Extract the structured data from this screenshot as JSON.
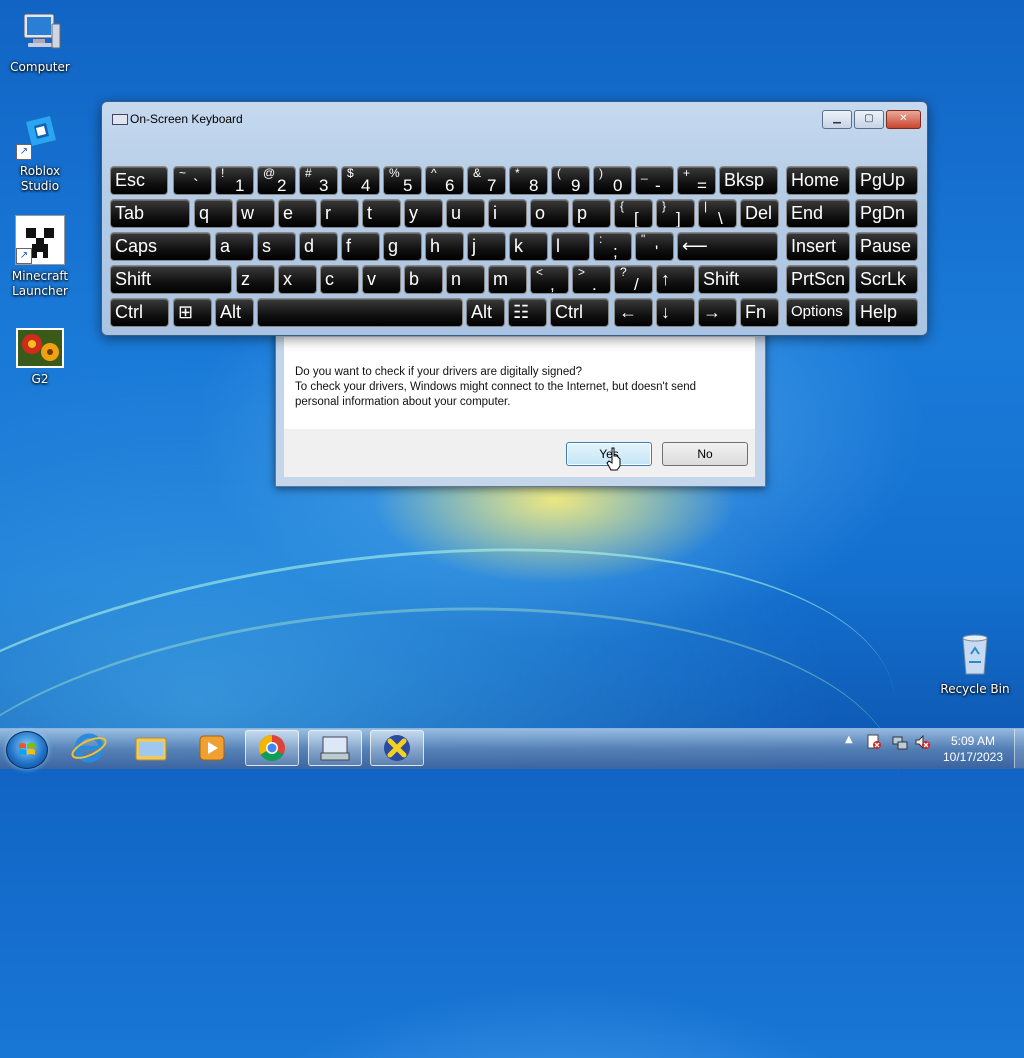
{
  "desktop": {
    "icons": [
      {
        "label": "Computer"
      },
      {
        "label": "Roblox Studio"
      },
      {
        "label": "Minecraft Launcher"
      },
      {
        "label": "G2"
      },
      {
        "label": "Recycle Bin"
      }
    ]
  },
  "osk": {
    "title": "On-Screen Keyboard",
    "rows": [
      [
        {
          "main": "Esc"
        },
        {
          "top": "~",
          "bot": "`"
        },
        {
          "top": "!",
          "bot": "1"
        },
        {
          "top": "@",
          "bot": "2"
        },
        {
          "top": "#",
          "bot": "3"
        },
        {
          "top": "$",
          "bot": "4"
        },
        {
          "top": "%",
          "bot": "5"
        },
        {
          "top": "^",
          "bot": "6"
        },
        {
          "top": "&",
          "bot": "7"
        },
        {
          "top": "*",
          "bot": "8"
        },
        {
          "top": "(",
          "bot": "9"
        },
        {
          "top": ")",
          "bot": "0"
        },
        {
          "top": "_",
          "bot": "-"
        },
        {
          "top": "+",
          "bot": "="
        },
        {
          "main": "Bksp"
        },
        {
          "main": "Home"
        },
        {
          "main": "PgUp"
        }
      ],
      [
        {
          "main": "Tab"
        },
        {
          "main": "q"
        },
        {
          "main": "w"
        },
        {
          "main": "e"
        },
        {
          "main": "r"
        },
        {
          "main": "t"
        },
        {
          "main": "y"
        },
        {
          "main": "u"
        },
        {
          "main": "i"
        },
        {
          "main": "o"
        },
        {
          "main": "p"
        },
        {
          "top": "{",
          "bot": "["
        },
        {
          "top": "}",
          "bot": "]"
        },
        {
          "top": "|",
          "bot": "\\"
        },
        {
          "main": "Del"
        },
        {
          "main": "End"
        },
        {
          "main": "PgDn"
        }
      ],
      [
        {
          "main": "Caps"
        },
        {
          "main": "a"
        },
        {
          "main": "s"
        },
        {
          "main": "d"
        },
        {
          "main": "f"
        },
        {
          "main": "g"
        },
        {
          "main": "h"
        },
        {
          "main": "j"
        },
        {
          "main": "k"
        },
        {
          "main": "l"
        },
        {
          "top": ":",
          "bot": ";"
        },
        {
          "top": "\"",
          "bot": "'"
        },
        {
          "main": "⟵"
        },
        {
          "main": "Insert"
        },
        {
          "main": "Pause"
        }
      ],
      [
        {
          "main": "Shift"
        },
        {
          "main": "z"
        },
        {
          "main": "x"
        },
        {
          "main": "c"
        },
        {
          "main": "v"
        },
        {
          "main": "b"
        },
        {
          "main": "n"
        },
        {
          "main": "m"
        },
        {
          "top": "<",
          "bot": ","
        },
        {
          "top": ">",
          "bot": "."
        },
        {
          "top": "?",
          "bot": "/"
        },
        {
          "main": "↑"
        },
        {
          "main": "Shift"
        },
        {
          "main": "PrtScn"
        },
        {
          "main": "ScrLk"
        }
      ],
      [
        {
          "main": "Ctrl"
        },
        {
          "main": "⊞"
        },
        {
          "main": "Alt"
        },
        {
          "main": ""
        },
        {
          "main": "Alt"
        },
        {
          "main": "☷"
        },
        {
          "main": "Ctrl"
        },
        {
          "main": "←"
        },
        {
          "main": "↓"
        },
        {
          "main": "→"
        },
        {
          "main": "Fn"
        },
        {
          "main": "Options"
        },
        {
          "main": "Help"
        }
      ]
    ]
  },
  "dialog": {
    "line1": "Do you want to check if your drivers are digitally signed?",
    "line2": "To check your drivers, Windows might connect to the Internet, but doesn't send",
    "line3": "personal information about your computer.",
    "yes": "Yes",
    "no": "No"
  },
  "taskbar": {
    "time": "5:09 AM",
    "date": "10/17/2023"
  }
}
